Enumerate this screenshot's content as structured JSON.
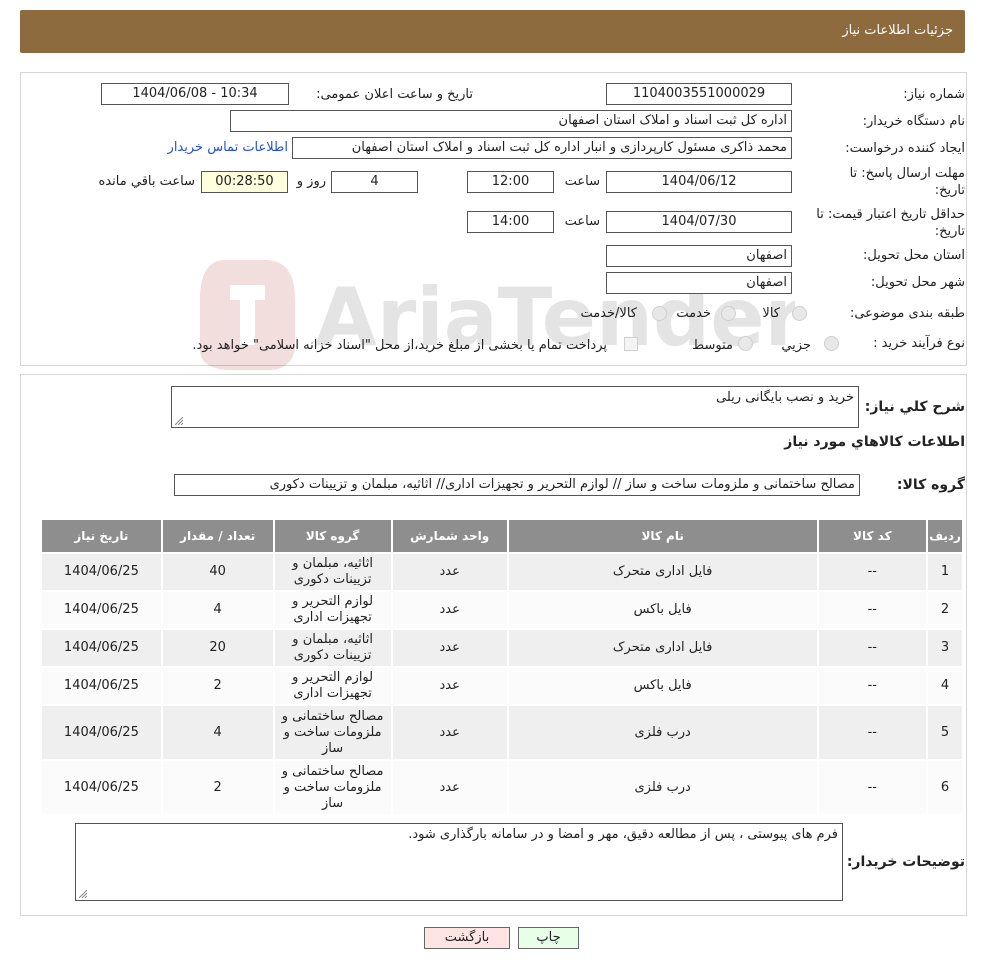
{
  "header": {
    "title": "جزئیات اطلاعات نیاز"
  },
  "form": {
    "need_number_label": "شماره نیاز:",
    "need_number": "1104003551000029",
    "announce_label": "تاریخ و ساعت اعلان عمومی:",
    "announce_value": "1404/06/08 - 10:34",
    "buyer_org_label": "نام دستگاه خریدار:",
    "buyer_org": "اداره کل ثبت اسناد و املاک استان اصفهان",
    "creator_label": "ایجاد کننده درخواست:",
    "creator": "محمد ذاکری مسئول کارپردازی و انبار اداره کل ثبت اسناد و املاک استان اصفهان",
    "contact_link": "اطلاعات تماس خریدار",
    "deadline_label_1": "مهلت ارسال پاسخ: تا",
    "deadline_label_2": "تاریخ:",
    "deadline_date": "1404/06/12",
    "time_label": "ساعت",
    "deadline_time": "12:00",
    "days": "4",
    "days_label": "روز و",
    "remaining": "00:28:50",
    "remaining_label": "ساعت باقي مانده",
    "validity_label_1": "حداقل تاریخ اعتبار قیمت: تا",
    "validity_label_2": "تاریخ:",
    "validity_date": "1404/07/30",
    "validity_time": "14:00",
    "province_label": "استان محل تحویل:",
    "province": "اصفهان",
    "city_label": "شهر محل تحویل:",
    "city": "اصفهان",
    "category_label": "طبقه بندی موضوعی:",
    "cat_goods": "کالا",
    "cat_service": "خدمت",
    "cat_both": "کالا/خدمت",
    "process_label": "نوع فرآیند خرید :",
    "proc_small": "جزیي",
    "proc_medium": "متوسط",
    "payment_note": "پرداخت تمام یا بخشی از مبلغ خرید،از محل \"اسناد خزانه اسلامی\" خواهد بود."
  },
  "details": {
    "summary_label": "شرح كلي نياز:",
    "summary": "خرید و نصب بایگانی ریلی",
    "goods_info_title": "اطلاعات کالاهاي مورد نياز",
    "goods_group_label": "گروه کالا:",
    "goods_group": "مصالح ساختمانی و ملزومات ساخت و ساز // لوازم التحریر و تجهیزات اداری// اثاثیه، مبلمان و تزیینات دکوری",
    "table": {
      "headers": [
        "رديف",
        "کد کالا",
        "نام کالا",
        "واحد شمارش",
        "گروه کالا",
        "تعداد / مقدار",
        "تاریخ نیاز"
      ],
      "rows": [
        [
          "1",
          "--",
          "فایل اداری متحرک",
          "عدد",
          "اثاثیه، مبلمان و تزیینات دکوری",
          "40",
          "1404/06/25"
        ],
        [
          "2",
          "--",
          "فایل باکس",
          "عدد",
          "لوازم التحریر و تجهیزات اداری",
          "4",
          "1404/06/25"
        ],
        [
          "3",
          "--",
          "فایل اداری متحرک",
          "عدد",
          "اثاثیه، مبلمان و تزیینات دکوری",
          "20",
          "1404/06/25"
        ],
        [
          "4",
          "--",
          "فایل باکس",
          "عدد",
          "لوازم التحریر و تجهیزات اداری",
          "2",
          "1404/06/25"
        ],
        [
          "5",
          "--",
          "درب فلزی",
          "عدد",
          "مصالح ساختمانی و ملزومات ساخت و ساز",
          "4",
          "1404/06/25"
        ],
        [
          "6",
          "--",
          "درب فلزی",
          "عدد",
          "مصالح ساختمانی و ملزومات ساخت و ساز",
          "2",
          "1404/06/25"
        ]
      ]
    },
    "buyer_notes_label": "توضیحات خریدار:",
    "buyer_notes": "فرم های پیوستی ، پس از مطالعه دقیق، مهر و امضا و در سامانه بارگذاری شود."
  },
  "buttons": {
    "print": "چاپ",
    "back": "بازگشت"
  },
  "watermark": {
    "text": "AriaTender.neT"
  },
  "colors": {
    "header": "#8e6b3f",
    "table_header": "#8e8e8e",
    "link": "#2152d6",
    "back_button": "#ffe4e4",
    "print_button": "#e6ffe6"
  }
}
